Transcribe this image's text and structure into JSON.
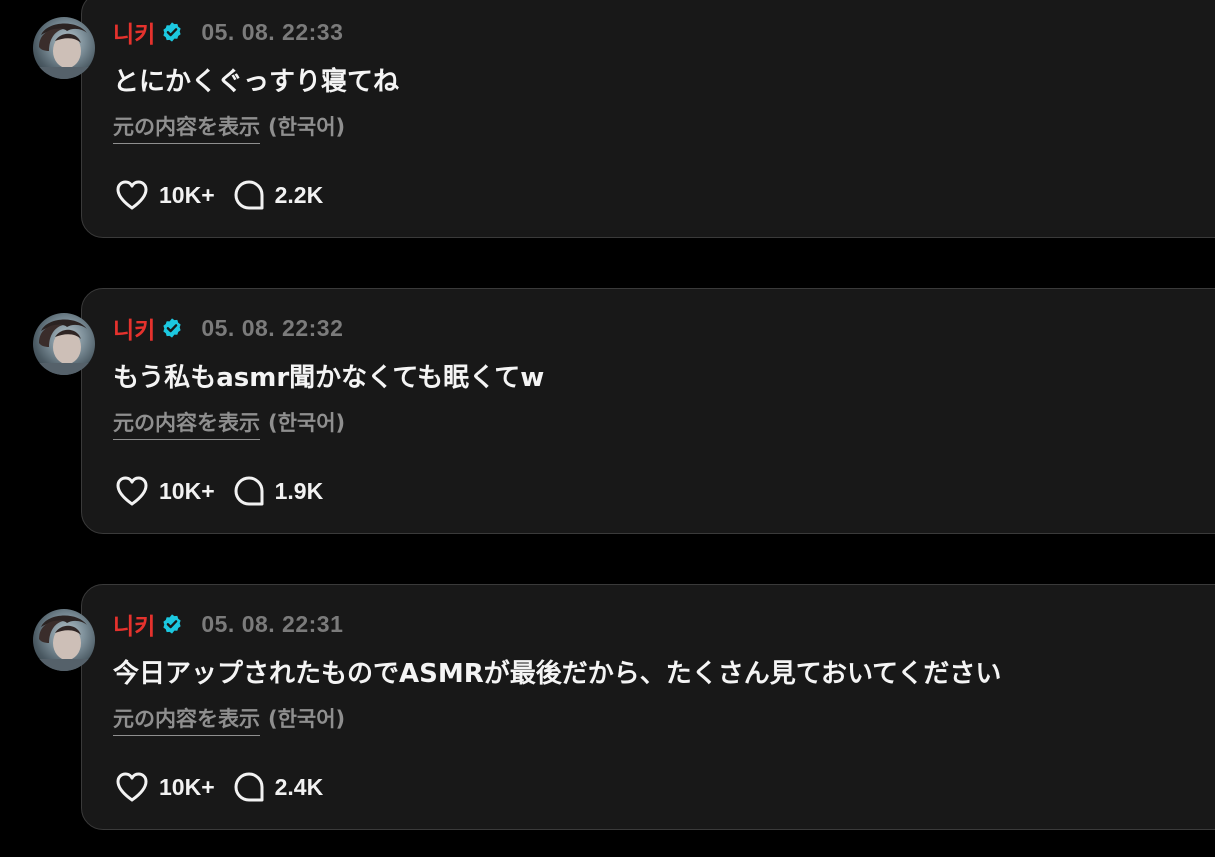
{
  "colors": {
    "background": "#000000",
    "card": "#181818",
    "card_border": "#3a3a3a",
    "author": "#e5322d",
    "verified": "#1cc8e0",
    "muted": "#7b7b7b",
    "text": "#f4f4f4"
  },
  "icons": {
    "like": "heart-icon",
    "reply": "speech-bubble-icon",
    "verified": "verified-badge-icon"
  },
  "posts": [
    {
      "author": "니키",
      "timestamp": "05. 08. 22:33",
      "text": "とにかくぐっすり寝てね",
      "translate_label": "元の内容を表示",
      "translate_lang": "(한국어)",
      "likes": "10K+",
      "replies": "2.2K"
    },
    {
      "author": "니키",
      "timestamp": "05. 08. 22:32",
      "text": "もう私もasmr聞かなくても眠くてw",
      "translate_label": "元の内容を表示",
      "translate_lang": "(한국어)",
      "likes": "10K+",
      "replies": "1.9K"
    },
    {
      "author": "니키",
      "timestamp": "05. 08. 22:31",
      "text": "今日アップされたものでASMRが最後だから、たくさん見ておいてください",
      "translate_label": "元の内容を表示",
      "translate_lang": "(한국어)",
      "likes": "10K+",
      "replies": "2.4K"
    }
  ]
}
